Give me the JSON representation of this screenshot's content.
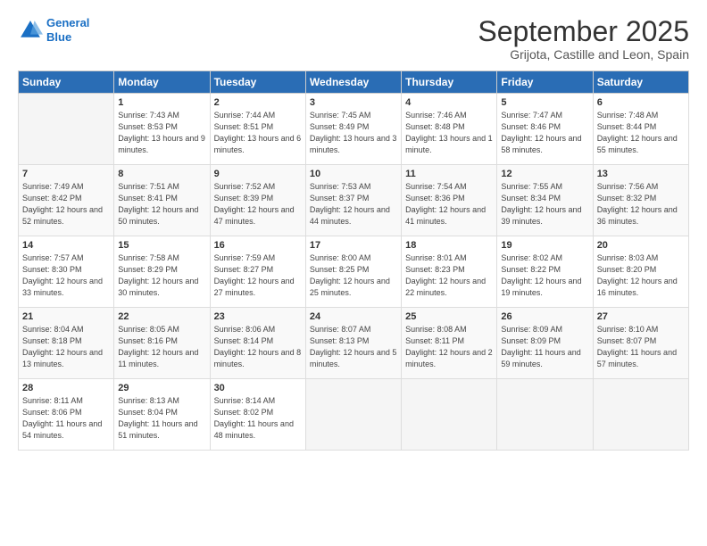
{
  "header": {
    "logo_line1": "General",
    "logo_line2": "Blue",
    "month_title": "September 2025",
    "subtitle": "Grijota, Castille and Leon, Spain"
  },
  "days_of_week": [
    "Sunday",
    "Monday",
    "Tuesday",
    "Wednesday",
    "Thursday",
    "Friday",
    "Saturday"
  ],
  "weeks": [
    [
      {
        "day": "",
        "sunrise": "",
        "sunset": "",
        "daylight": ""
      },
      {
        "day": "1",
        "sunrise": "Sunrise: 7:43 AM",
        "sunset": "Sunset: 8:53 PM",
        "daylight": "Daylight: 13 hours and 9 minutes."
      },
      {
        "day": "2",
        "sunrise": "Sunrise: 7:44 AM",
        "sunset": "Sunset: 8:51 PM",
        "daylight": "Daylight: 13 hours and 6 minutes."
      },
      {
        "day": "3",
        "sunrise": "Sunrise: 7:45 AM",
        "sunset": "Sunset: 8:49 PM",
        "daylight": "Daylight: 13 hours and 3 minutes."
      },
      {
        "day": "4",
        "sunrise": "Sunrise: 7:46 AM",
        "sunset": "Sunset: 8:48 PM",
        "daylight": "Daylight: 13 hours and 1 minute."
      },
      {
        "day": "5",
        "sunrise": "Sunrise: 7:47 AM",
        "sunset": "Sunset: 8:46 PM",
        "daylight": "Daylight: 12 hours and 58 minutes."
      },
      {
        "day": "6",
        "sunrise": "Sunrise: 7:48 AM",
        "sunset": "Sunset: 8:44 PM",
        "daylight": "Daylight: 12 hours and 55 minutes."
      }
    ],
    [
      {
        "day": "7",
        "sunrise": "Sunrise: 7:49 AM",
        "sunset": "Sunset: 8:42 PM",
        "daylight": "Daylight: 12 hours and 52 minutes."
      },
      {
        "day": "8",
        "sunrise": "Sunrise: 7:51 AM",
        "sunset": "Sunset: 8:41 PM",
        "daylight": "Daylight: 12 hours and 50 minutes."
      },
      {
        "day": "9",
        "sunrise": "Sunrise: 7:52 AM",
        "sunset": "Sunset: 8:39 PM",
        "daylight": "Daylight: 12 hours and 47 minutes."
      },
      {
        "day": "10",
        "sunrise": "Sunrise: 7:53 AM",
        "sunset": "Sunset: 8:37 PM",
        "daylight": "Daylight: 12 hours and 44 minutes."
      },
      {
        "day": "11",
        "sunrise": "Sunrise: 7:54 AM",
        "sunset": "Sunset: 8:36 PM",
        "daylight": "Daylight: 12 hours and 41 minutes."
      },
      {
        "day": "12",
        "sunrise": "Sunrise: 7:55 AM",
        "sunset": "Sunset: 8:34 PM",
        "daylight": "Daylight: 12 hours and 39 minutes."
      },
      {
        "day": "13",
        "sunrise": "Sunrise: 7:56 AM",
        "sunset": "Sunset: 8:32 PM",
        "daylight": "Daylight: 12 hours and 36 minutes."
      }
    ],
    [
      {
        "day": "14",
        "sunrise": "Sunrise: 7:57 AM",
        "sunset": "Sunset: 8:30 PM",
        "daylight": "Daylight: 12 hours and 33 minutes."
      },
      {
        "day": "15",
        "sunrise": "Sunrise: 7:58 AM",
        "sunset": "Sunset: 8:29 PM",
        "daylight": "Daylight: 12 hours and 30 minutes."
      },
      {
        "day": "16",
        "sunrise": "Sunrise: 7:59 AM",
        "sunset": "Sunset: 8:27 PM",
        "daylight": "Daylight: 12 hours and 27 minutes."
      },
      {
        "day": "17",
        "sunrise": "Sunrise: 8:00 AM",
        "sunset": "Sunset: 8:25 PM",
        "daylight": "Daylight: 12 hours and 25 minutes."
      },
      {
        "day": "18",
        "sunrise": "Sunrise: 8:01 AM",
        "sunset": "Sunset: 8:23 PM",
        "daylight": "Daylight: 12 hours and 22 minutes."
      },
      {
        "day": "19",
        "sunrise": "Sunrise: 8:02 AM",
        "sunset": "Sunset: 8:22 PM",
        "daylight": "Daylight: 12 hours and 19 minutes."
      },
      {
        "day": "20",
        "sunrise": "Sunrise: 8:03 AM",
        "sunset": "Sunset: 8:20 PM",
        "daylight": "Daylight: 12 hours and 16 minutes."
      }
    ],
    [
      {
        "day": "21",
        "sunrise": "Sunrise: 8:04 AM",
        "sunset": "Sunset: 8:18 PM",
        "daylight": "Daylight: 12 hours and 13 minutes."
      },
      {
        "day": "22",
        "sunrise": "Sunrise: 8:05 AM",
        "sunset": "Sunset: 8:16 PM",
        "daylight": "Daylight: 12 hours and 11 minutes."
      },
      {
        "day": "23",
        "sunrise": "Sunrise: 8:06 AM",
        "sunset": "Sunset: 8:14 PM",
        "daylight": "Daylight: 12 hours and 8 minutes."
      },
      {
        "day": "24",
        "sunrise": "Sunrise: 8:07 AM",
        "sunset": "Sunset: 8:13 PM",
        "daylight": "Daylight: 12 hours and 5 minutes."
      },
      {
        "day": "25",
        "sunrise": "Sunrise: 8:08 AM",
        "sunset": "Sunset: 8:11 PM",
        "daylight": "Daylight: 12 hours and 2 minutes."
      },
      {
        "day": "26",
        "sunrise": "Sunrise: 8:09 AM",
        "sunset": "Sunset: 8:09 PM",
        "daylight": "Daylight: 11 hours and 59 minutes."
      },
      {
        "day": "27",
        "sunrise": "Sunrise: 8:10 AM",
        "sunset": "Sunset: 8:07 PM",
        "daylight": "Daylight: 11 hours and 57 minutes."
      }
    ],
    [
      {
        "day": "28",
        "sunrise": "Sunrise: 8:11 AM",
        "sunset": "Sunset: 8:06 PM",
        "daylight": "Daylight: 11 hours and 54 minutes."
      },
      {
        "day": "29",
        "sunrise": "Sunrise: 8:13 AM",
        "sunset": "Sunset: 8:04 PM",
        "daylight": "Daylight: 11 hours and 51 minutes."
      },
      {
        "day": "30",
        "sunrise": "Sunrise: 8:14 AM",
        "sunset": "Sunset: 8:02 PM",
        "daylight": "Daylight: 11 hours and 48 minutes."
      },
      {
        "day": "",
        "sunrise": "",
        "sunset": "",
        "daylight": ""
      },
      {
        "day": "",
        "sunrise": "",
        "sunset": "",
        "daylight": ""
      },
      {
        "day": "",
        "sunrise": "",
        "sunset": "",
        "daylight": ""
      },
      {
        "day": "",
        "sunrise": "",
        "sunset": "",
        "daylight": ""
      }
    ]
  ]
}
